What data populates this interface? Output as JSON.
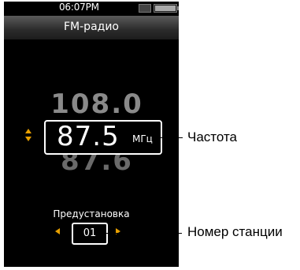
{
  "status_bar": {
    "time": "06:07PM"
  },
  "title_bar": {
    "title": "FM-радио"
  },
  "tuner": {
    "previous_frequency": "108.0",
    "current_frequency": "87.5",
    "unit": "МГц",
    "next_frequency": "87.6"
  },
  "preset": {
    "label": "Предустановка",
    "number": "01"
  },
  "callouts": {
    "frequency": "Частота",
    "station_number": "Номер станции"
  },
  "colors": {
    "accent": "#e8a000",
    "background": "#000000",
    "text": "#ffffff"
  },
  "icons": [
    "hold-icon",
    "battery-icon",
    "tune-up-arrow-icon",
    "tune-down-arrow-icon",
    "preset-prev-arrow-icon",
    "preset-next-arrow-icon"
  ],
  "battery": {
    "level": 1.0
  }
}
